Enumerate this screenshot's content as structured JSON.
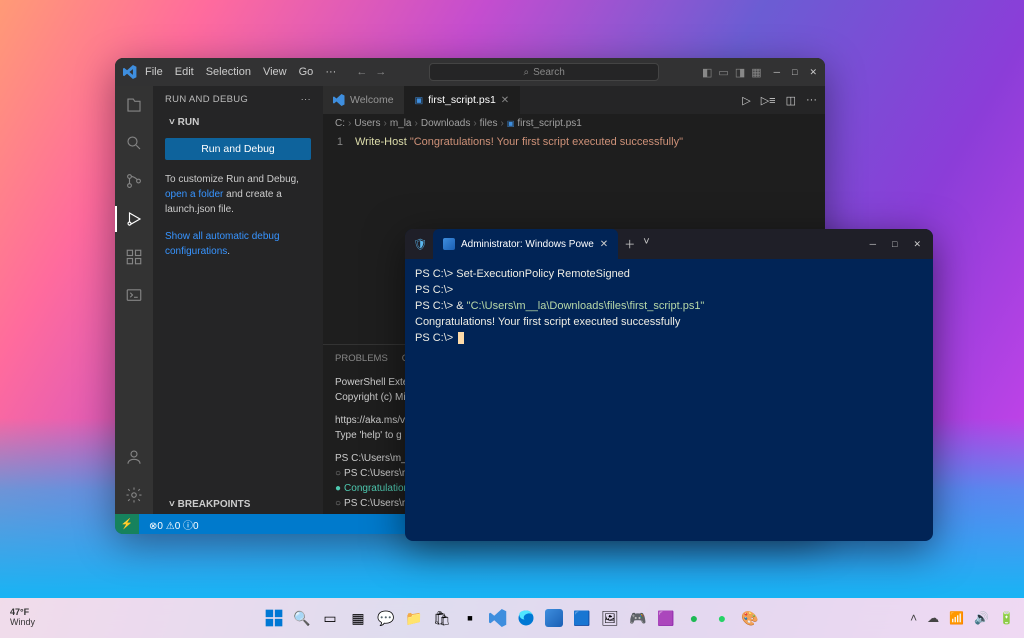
{
  "vscode": {
    "menus": [
      "File",
      "Edit",
      "Selection",
      "View",
      "Go"
    ],
    "search_placeholder": "Search",
    "sidebar_title": "RUN AND DEBUG",
    "section_run": "RUN",
    "run_button": "Run and Debug",
    "customize_pre": "To customize Run and Debug, ",
    "customize_link1": "open a folder",
    "customize_mid": " and create a launch.json file.",
    "show_all_link": "Show all automatic debug configurations",
    "breakpoints_label": "BREAKPOINTS",
    "tabs": [
      {
        "icon": "vscode",
        "label": "Welcome",
        "active": false
      },
      {
        "icon": "ps",
        "label": "first_script.ps1",
        "active": true,
        "close": true
      }
    ],
    "breadcrumb": [
      "C:",
      "Users",
      "m_la",
      "Downloads",
      "files",
      "first_script.ps1"
    ],
    "breadcrumb_icon_file": "first_script.ps1",
    "code": {
      "line_no": "1",
      "cmd": "Write-Host",
      "str": "\"Congratulations! Your first script executed successfully\""
    },
    "panel_tabs": [
      "PROBLEMS",
      "OUTPU"
    ],
    "panel_output": {
      "l1": "PowerShell Exten",
      "l2": "Copyright (c) Mi",
      "l3": "https://aka.ms/v",
      "l4": "Type 'help' to g",
      "l5": "PS C:\\Users\\m_la",
      "l6": "PS C:\\Users\\m__la",
      "l7": "Congratulations!",
      "l8": "PS C:\\Users\\m__la"
    },
    "status": {
      "errors": "0",
      "warnings": "0",
      "info": "0"
    }
  },
  "terminal": {
    "tab_title": "Administrator: Windows Powe",
    "lines": [
      {
        "prompt": "PS C:\\>",
        "text": " Set-ExecutionPolicy RemoteSigned"
      },
      {
        "prompt": "PS C:\\>",
        "text": ""
      },
      {
        "prompt": "PS C:\\>",
        "text": " & ",
        "path": "\"C:\\Users\\m__la\\Downloads\\files\\first_script.ps1\""
      },
      {
        "plain": "Congratulations! Your first script executed successfully"
      },
      {
        "prompt": "PS C:\\>",
        "cursor": true
      }
    ]
  },
  "taskbar": {
    "temp": "47°F",
    "weather": "Windy"
  }
}
